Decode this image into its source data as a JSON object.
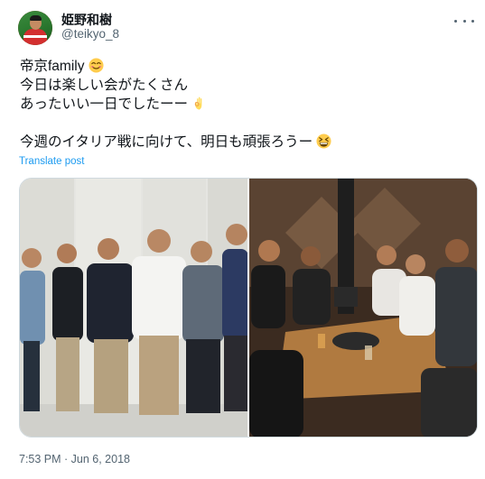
{
  "user": {
    "display_name": "姫野和樹",
    "handle": "@teikyo_8"
  },
  "icons": {
    "avatar": "profile-photo",
    "more": "more-horizontal-icon",
    "smile_emoji": "smiling-face-emoji",
    "ok_emoji": "ok-hand-emoji",
    "laugh_emoji": "grinning-squinting-face-emoji"
  },
  "tweet": {
    "line1": "帝京family",
    "line2": "今日は楽しい会がたくさん",
    "line3": "あったいい一日でしたーー",
    "line4": "今週のイタリア戦に向けて、明日も頑張ろうー"
  },
  "translate_label": "Translate post",
  "media": {
    "photo_left": "group-photo-office",
    "photo_right": "group-photo-restaurant"
  },
  "timestamp": "7:53 PM · Jun 6, 2018",
  "colors": {
    "link": "#1d9bf0",
    "secondary_text": "#536471",
    "border": "#cfd9de"
  }
}
